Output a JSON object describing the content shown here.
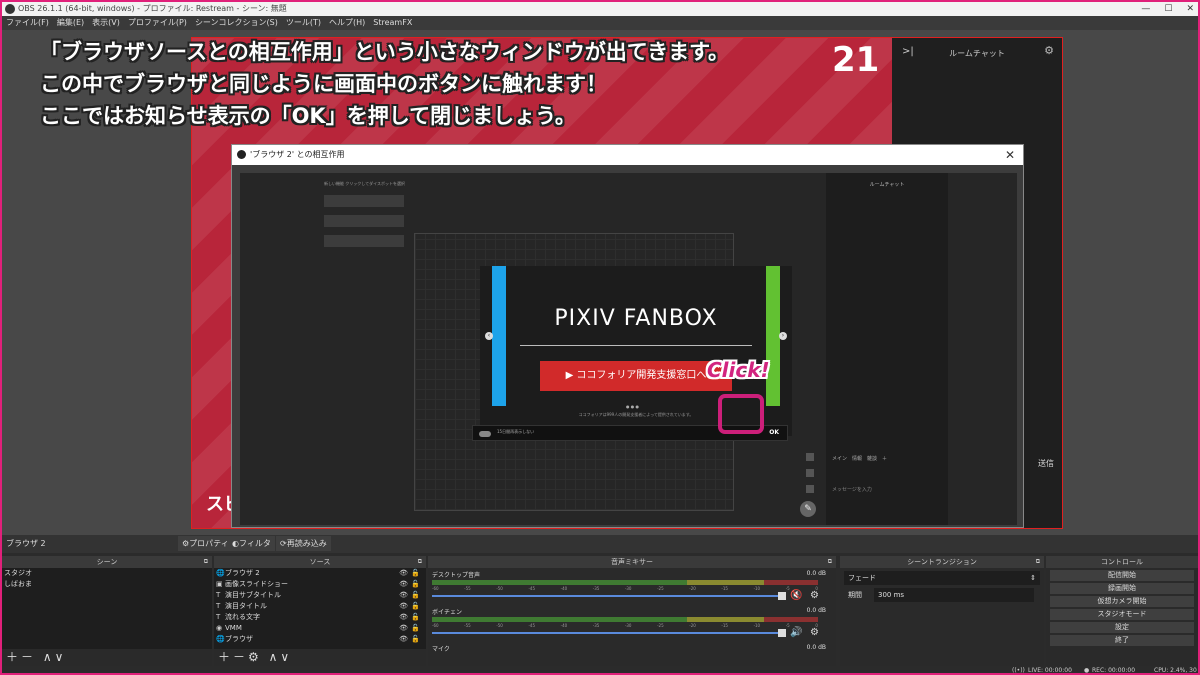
{
  "window": {
    "title": "OBS 26.1.1 (64-bit, windows) - プロファイル: Restream - シーン: 無題",
    "min": "—",
    "max": "☐",
    "close": "✕"
  },
  "menu": [
    "ファイル(F)",
    "編集(E)",
    "表示(V)",
    "プロファイル(P)",
    "シーンコレクション(S)",
    "ツール(T)",
    "ヘルプ(H)",
    "StreamFX"
  ],
  "caption": {
    "line1": "「ブラウザソースとの相互作用」という小さなウィンドウが出てきます。",
    "line2": "この中でブラウザと同じように画面中のボタンに触れます！",
    "line3": "ここではお知らせ表示の「OK」を押して閉じましょう。"
  },
  "stage": {
    "big_num": "21",
    "bottom_left": "スピ",
    "right_label": "送信",
    "chat_title": "ルームチャット"
  },
  "dialog": {
    "title": "'ブラウザ 2' との相互作用",
    "close": "✕",
    "hint": "新しい機能 クリックしてダイスボットを選択",
    "room_chat": "ルームチャット",
    "chat_tabs": "メイン　情報　雑談　＋",
    "chat_placeholder": "メッセージを入力",
    "fanbox": {
      "logo": "PIXIV FANBOX",
      "cta": "▶ ココフォリア開発支援窓口へ",
      "credit": "ココフォリアは999人の開発支援者によって提供されています。",
      "dots": "● ● ●"
    },
    "notice": {
      "text": "15日間再表示しない",
      "ok": "OK"
    }
  },
  "click_label": "Click!",
  "source_bar": {
    "selected": "ブラウザ 2",
    "props": "⚙プロパティ",
    "filter": "◐フィルタ",
    "reload": "⟳再読み込み"
  },
  "scenes": {
    "header": "シーン",
    "items": [
      "スタジオ",
      "しばおま"
    ],
    "footer": "＋－ ∧∨"
  },
  "sources": {
    "header": "ソース",
    "items": [
      {
        "icon": "🌐",
        "label": "ブラウザ 2"
      },
      {
        "icon": "▣",
        "label": "画像スライドショー"
      },
      {
        "icon": "T",
        "label": "演目サブタイトル"
      },
      {
        "icon": "T",
        "label": "演目タイトル"
      },
      {
        "icon": "T",
        "label": "流れる文字"
      },
      {
        "icon": "◉",
        "label": "VMM"
      },
      {
        "icon": "🌐",
        "label": "ブラウザ"
      }
    ],
    "footer": "＋－⚙ ∧∨"
  },
  "mixer": {
    "header": "音声ミキサー",
    "tracks": [
      {
        "name": "デスクトップ音声",
        "db": "0.0 dB",
        "spk": "🔇"
      },
      {
        "name": "ボイチェン",
        "db": "0.0 dB",
        "spk": "🔊"
      },
      {
        "name": "マイク",
        "db": "0.0 dB",
        "spk": ""
      }
    ],
    "scale": [
      "-60",
      "-55",
      "-50",
      "-45",
      "-40",
      "-35",
      "-30",
      "-25",
      "-20",
      "-15",
      "-10",
      "-5",
      "0"
    ]
  },
  "transitions": {
    "header": "シーントランジション",
    "type": "フェード",
    "duration_label": "期間",
    "duration": "300 ms"
  },
  "controls": {
    "header": "コントロール",
    "buttons": [
      "配信開始",
      "録画開始",
      "仮想カメラ開始",
      "スタジオモード",
      "設定",
      "終了"
    ]
  },
  "status": {
    "live": "LIVE: 00:00:00",
    "rec": "REC: 00:00:00",
    "cpu": "CPU: 2.4%, 30"
  }
}
